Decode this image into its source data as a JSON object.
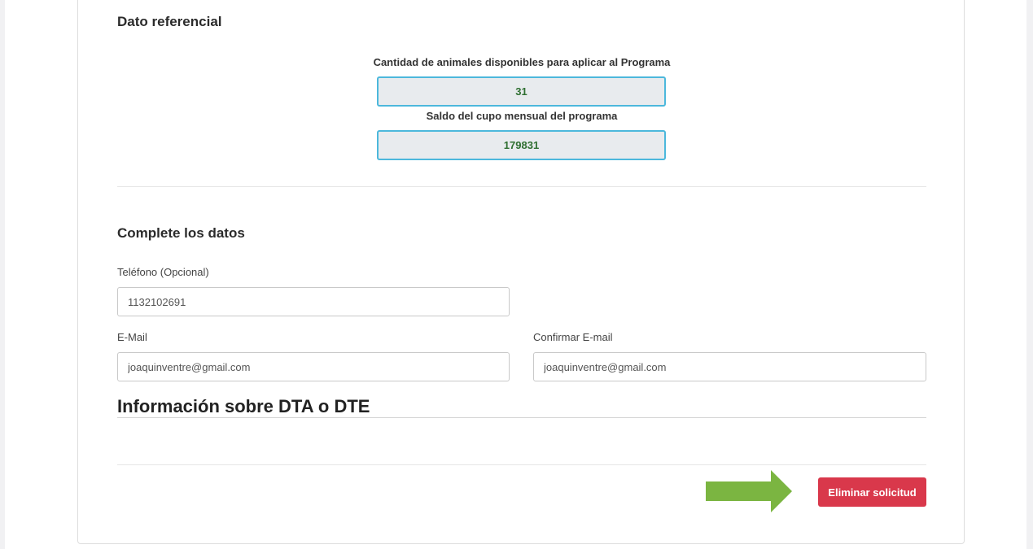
{
  "reference": {
    "title": "Dato referencial",
    "animals_label": "Cantidad de animales disponibles para aplicar al Programa",
    "animals_value": "31",
    "quota_label": "Saldo del cupo mensual del programa",
    "quota_value": "179831"
  },
  "form": {
    "title": "Complete los datos",
    "phone_label": "Teléfono (Opcional)",
    "phone_value": "1132102691",
    "email_label": "E-Mail",
    "email_value": "joaquinventre@gmail.com",
    "confirm_email_label": "Confirmar E-mail",
    "confirm_email_value": "joaquinventre@gmail.com"
  },
  "dta": {
    "title": "Información sobre DTA o DTE"
  },
  "actions": {
    "delete_label": "Eliminar solicitud"
  },
  "colors": {
    "danger": "#d9384b",
    "ref_border": "#4cb8dc",
    "ref_value": "#2f6f31",
    "arrow": "#7bb541"
  },
  "icons": {
    "pointer": "right-arrow-icon"
  }
}
